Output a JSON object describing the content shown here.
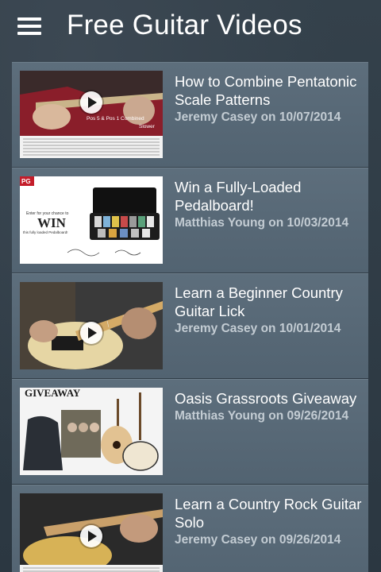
{
  "header": {
    "title": "Free Guitar Videos",
    "menu_icon": "hamburger-menu-icon"
  },
  "videos": [
    {
      "title": "How to Combine Pentatonic Scale Patterns",
      "author": "Jeremy Casey",
      "date": "10/07/2014",
      "meta": "Jeremy Casey on 10/07/2014",
      "thumb_caption_1": "Pos 5 & Pos 1 Combined",
      "thumb_caption_2": "Slower",
      "has_play": true
    },
    {
      "title": "Win a Fully-Loaded Pedalboard!",
      "author": "Matthias Young",
      "date": "10/03/2014",
      "meta": "Matthias Young on 10/03/2014",
      "thumb_logo": "PG",
      "thumb_line_1": "Enter for your chance to",
      "thumb_win": "WIN",
      "thumb_line_2": "this fully loaded Pedalboard!",
      "has_play": false
    },
    {
      "title": "Learn a Beginner Country Guitar Lick",
      "author": "Jeremy Casey",
      "date": "10/01/2014",
      "meta": "Jeremy Casey on 10/01/2014",
      "has_play": true
    },
    {
      "title": "Oasis Grassroots Giveaway",
      "author": "Matthias Young",
      "date": "09/26/2014",
      "meta": "Matthias Young on 09/26/2014",
      "thumb_banner": "GIVEAWAY",
      "has_play": false
    },
    {
      "title": "Learn a Country Rock Guitar Solo",
      "author": "Jeremy Casey",
      "date": "09/26/2014",
      "meta": "Jeremy Casey on 09/26/2014",
      "has_play": true
    }
  ],
  "colors": {
    "background": "#2f3b45",
    "card": "#5a6b79",
    "meta_text": "#c3ccd3",
    "title_text": "#ffffff"
  }
}
